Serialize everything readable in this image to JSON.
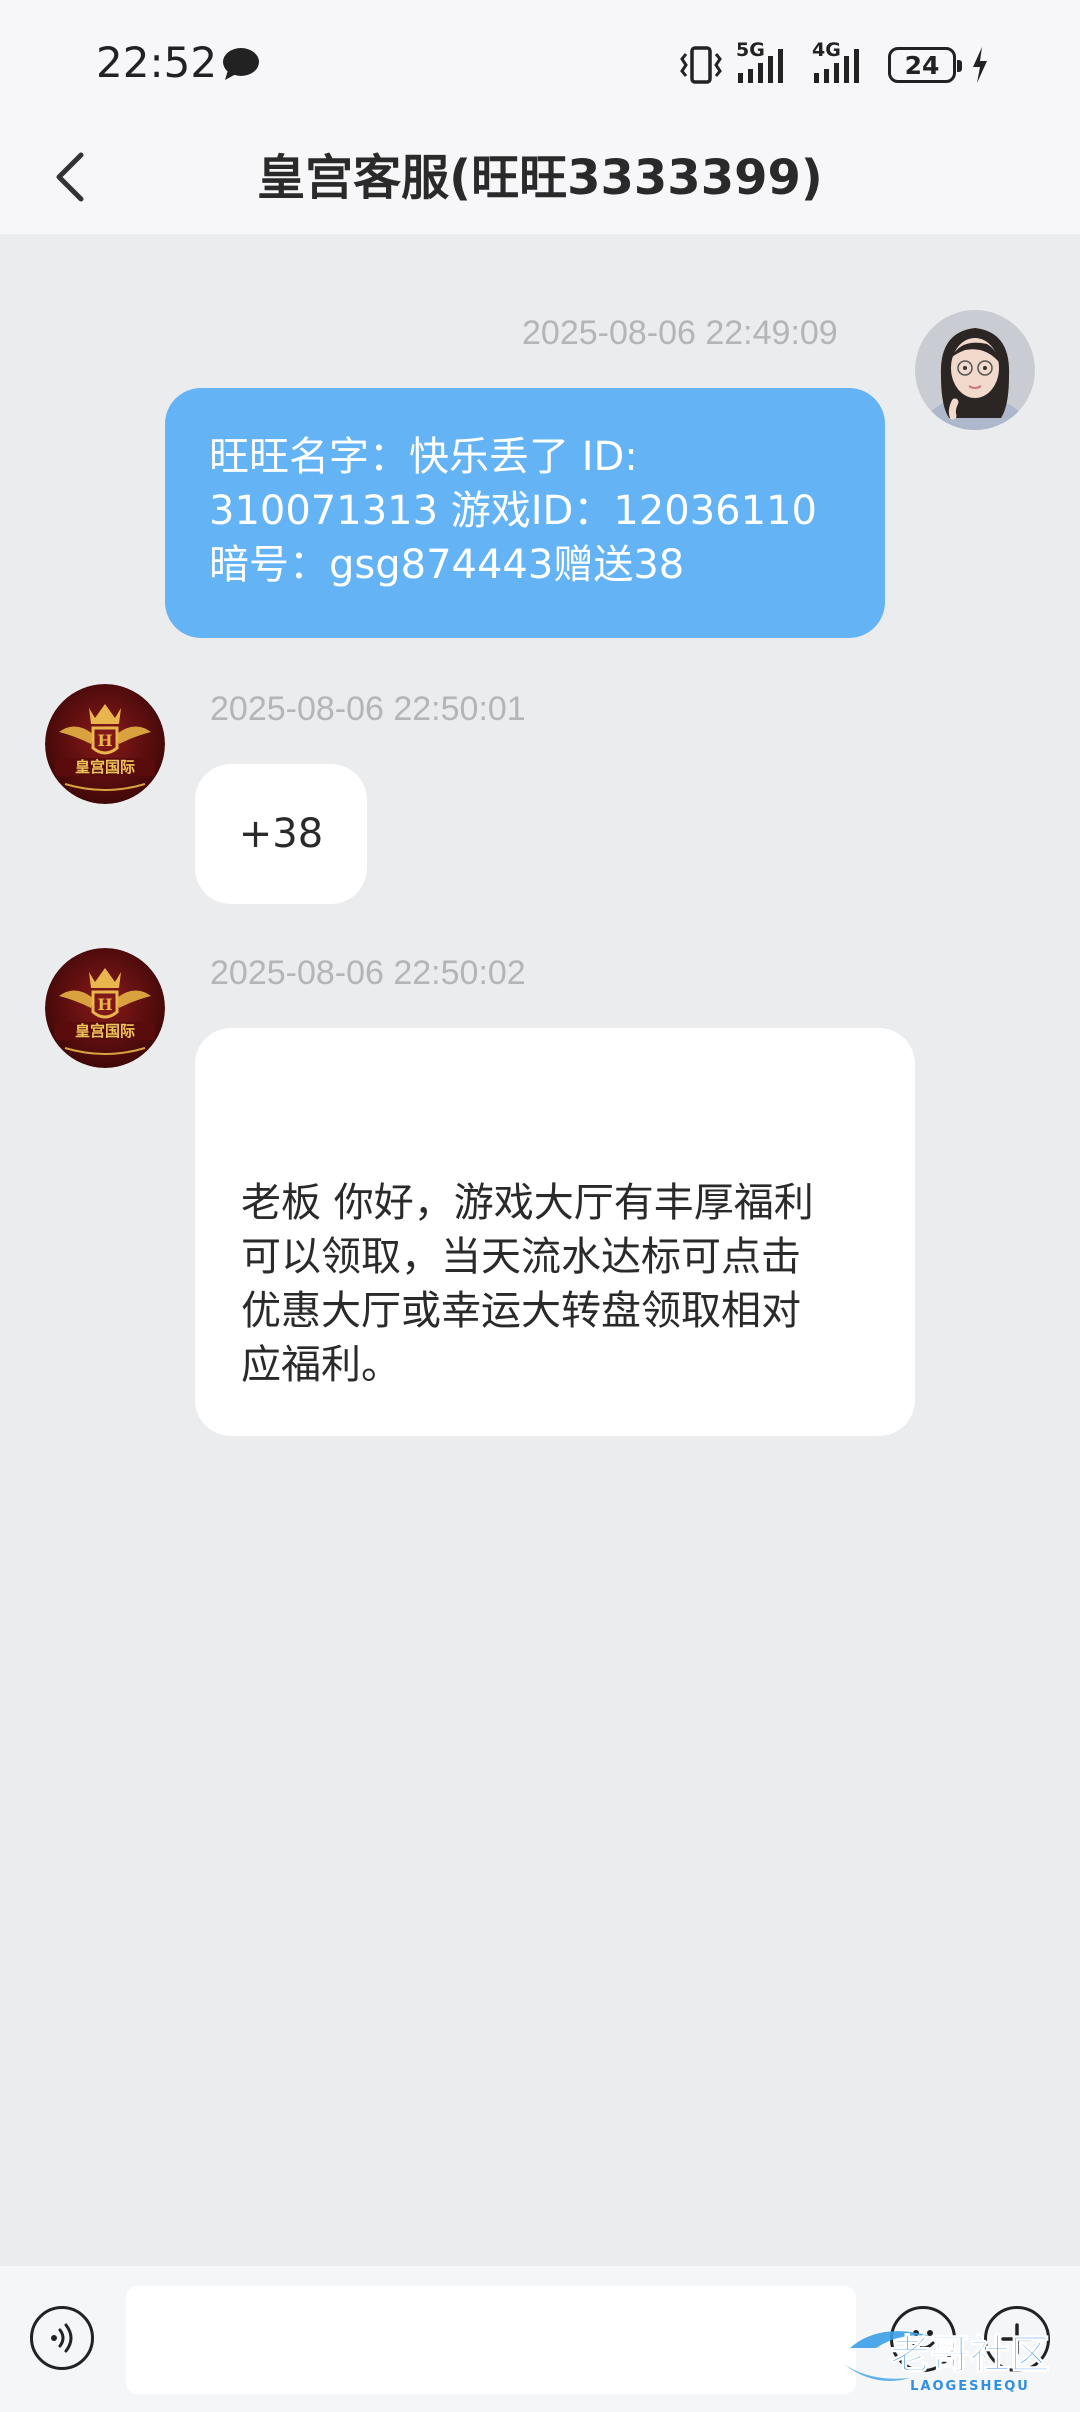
{
  "status_bar": {
    "time": "22:52",
    "network_1": "5G",
    "network_2": "4G",
    "battery_level": "24"
  },
  "header": {
    "title": "皇宫客服(旺旺3333399)"
  },
  "messages": [
    {
      "direction": "outgoing",
      "timestamp": "2025-08-06 22:49:09",
      "lines": [
        "旺旺名字：快乐丢了 ID:",
        "310071313 游戏ID：12036110",
        "暗号：gsg874443赠送38"
      ]
    },
    {
      "direction": "incoming",
      "timestamp": "2025-08-06 22:50:01",
      "text": "+38"
    },
    {
      "direction": "incoming",
      "timestamp": "2025-08-06 22:50:02",
      "lines": [
        "老板 你好，游戏大厅有丰厚福利",
        "可以领取，当天流水达标可点击",
        "优惠大厅或幸运大转盘领取相对",
        "应福利。"
      ]
    }
  ],
  "agent_avatar": {
    "logo_text": "皇宫国际"
  },
  "input_bar": {
    "value": "",
    "placeholder": ""
  },
  "watermark": {
    "text": "老哥社区",
    "subtext": "LAOGESHEQU"
  },
  "colors": {
    "background": "#EBECEE",
    "outgoing_bubble": "#63B3F5",
    "incoming_bubble": "#FFFFFF",
    "timestamp": "#B3B5B9"
  },
  "icons": [
    "chat-notification-icon",
    "vibrate-icon",
    "signal-icon",
    "battery-icon",
    "charging-icon",
    "back-icon",
    "voice-icon",
    "emoji-icon",
    "plus-icon"
  ]
}
